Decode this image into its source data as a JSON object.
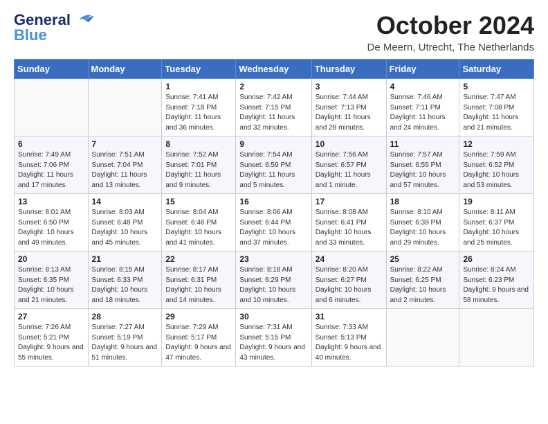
{
  "header": {
    "logo_general": "General",
    "logo_blue": "Blue",
    "month_title": "October 2024",
    "location": "De Meern, Utrecht, The Netherlands"
  },
  "days_of_week": [
    "Sunday",
    "Monday",
    "Tuesday",
    "Wednesday",
    "Thursday",
    "Friday",
    "Saturday"
  ],
  "weeks": [
    [
      {
        "day": "",
        "sunrise": "",
        "sunset": "",
        "daylight": ""
      },
      {
        "day": "",
        "sunrise": "",
        "sunset": "",
        "daylight": ""
      },
      {
        "day": "1",
        "sunrise": "Sunrise: 7:41 AM",
        "sunset": "Sunset: 7:18 PM",
        "daylight": "Daylight: 11 hours and 36 minutes."
      },
      {
        "day": "2",
        "sunrise": "Sunrise: 7:42 AM",
        "sunset": "Sunset: 7:15 PM",
        "daylight": "Daylight: 11 hours and 32 minutes."
      },
      {
        "day": "3",
        "sunrise": "Sunrise: 7:44 AM",
        "sunset": "Sunset: 7:13 PM",
        "daylight": "Daylight: 11 hours and 28 minutes."
      },
      {
        "day": "4",
        "sunrise": "Sunrise: 7:46 AM",
        "sunset": "Sunset: 7:11 PM",
        "daylight": "Daylight: 11 hours and 24 minutes."
      },
      {
        "day": "5",
        "sunrise": "Sunrise: 7:47 AM",
        "sunset": "Sunset: 7:08 PM",
        "daylight": "Daylight: 11 hours and 21 minutes."
      }
    ],
    [
      {
        "day": "6",
        "sunrise": "Sunrise: 7:49 AM",
        "sunset": "Sunset: 7:06 PM",
        "daylight": "Daylight: 11 hours and 17 minutes."
      },
      {
        "day": "7",
        "sunrise": "Sunrise: 7:51 AM",
        "sunset": "Sunset: 7:04 PM",
        "daylight": "Daylight: 11 hours and 13 minutes."
      },
      {
        "day": "8",
        "sunrise": "Sunrise: 7:52 AM",
        "sunset": "Sunset: 7:01 PM",
        "daylight": "Daylight: 11 hours and 9 minutes."
      },
      {
        "day": "9",
        "sunrise": "Sunrise: 7:54 AM",
        "sunset": "Sunset: 6:59 PM",
        "daylight": "Daylight: 11 hours and 5 minutes."
      },
      {
        "day": "10",
        "sunrise": "Sunrise: 7:56 AM",
        "sunset": "Sunset: 6:57 PM",
        "daylight": "Daylight: 11 hours and 1 minute."
      },
      {
        "day": "11",
        "sunrise": "Sunrise: 7:57 AM",
        "sunset": "Sunset: 6:55 PM",
        "daylight": "Daylight: 10 hours and 57 minutes."
      },
      {
        "day": "12",
        "sunrise": "Sunrise: 7:59 AM",
        "sunset": "Sunset: 6:52 PM",
        "daylight": "Daylight: 10 hours and 53 minutes."
      }
    ],
    [
      {
        "day": "13",
        "sunrise": "Sunrise: 8:01 AM",
        "sunset": "Sunset: 6:50 PM",
        "daylight": "Daylight: 10 hours and 49 minutes."
      },
      {
        "day": "14",
        "sunrise": "Sunrise: 8:03 AM",
        "sunset": "Sunset: 6:48 PM",
        "daylight": "Daylight: 10 hours and 45 minutes."
      },
      {
        "day": "15",
        "sunrise": "Sunrise: 8:04 AM",
        "sunset": "Sunset: 6:46 PM",
        "daylight": "Daylight: 10 hours and 41 minutes."
      },
      {
        "day": "16",
        "sunrise": "Sunrise: 8:06 AM",
        "sunset": "Sunset: 6:44 PM",
        "daylight": "Daylight: 10 hours and 37 minutes."
      },
      {
        "day": "17",
        "sunrise": "Sunrise: 8:08 AM",
        "sunset": "Sunset: 6:41 PM",
        "daylight": "Daylight: 10 hours and 33 minutes."
      },
      {
        "day": "18",
        "sunrise": "Sunrise: 8:10 AM",
        "sunset": "Sunset: 6:39 PM",
        "daylight": "Daylight: 10 hours and 29 minutes."
      },
      {
        "day": "19",
        "sunrise": "Sunrise: 8:11 AM",
        "sunset": "Sunset: 6:37 PM",
        "daylight": "Daylight: 10 hours and 25 minutes."
      }
    ],
    [
      {
        "day": "20",
        "sunrise": "Sunrise: 8:13 AM",
        "sunset": "Sunset: 6:35 PM",
        "daylight": "Daylight: 10 hours and 21 minutes."
      },
      {
        "day": "21",
        "sunrise": "Sunrise: 8:15 AM",
        "sunset": "Sunset: 6:33 PM",
        "daylight": "Daylight: 10 hours and 18 minutes."
      },
      {
        "day": "22",
        "sunrise": "Sunrise: 8:17 AM",
        "sunset": "Sunset: 6:31 PM",
        "daylight": "Daylight: 10 hours and 14 minutes."
      },
      {
        "day": "23",
        "sunrise": "Sunrise: 8:18 AM",
        "sunset": "Sunset: 6:29 PM",
        "daylight": "Daylight: 10 hours and 10 minutes."
      },
      {
        "day": "24",
        "sunrise": "Sunrise: 8:20 AM",
        "sunset": "Sunset: 6:27 PM",
        "daylight": "Daylight: 10 hours and 6 minutes."
      },
      {
        "day": "25",
        "sunrise": "Sunrise: 8:22 AM",
        "sunset": "Sunset: 6:25 PM",
        "daylight": "Daylight: 10 hours and 2 minutes."
      },
      {
        "day": "26",
        "sunrise": "Sunrise: 8:24 AM",
        "sunset": "Sunset: 6:23 PM",
        "daylight": "Daylight: 9 hours and 58 minutes."
      }
    ],
    [
      {
        "day": "27",
        "sunrise": "Sunrise: 7:26 AM",
        "sunset": "Sunset: 5:21 PM",
        "daylight": "Daylight: 9 hours and 55 minutes."
      },
      {
        "day": "28",
        "sunrise": "Sunrise: 7:27 AM",
        "sunset": "Sunset: 5:19 PM",
        "daylight": "Daylight: 9 hours and 51 minutes."
      },
      {
        "day": "29",
        "sunrise": "Sunrise: 7:29 AM",
        "sunset": "Sunset: 5:17 PM",
        "daylight": "Daylight: 9 hours and 47 minutes."
      },
      {
        "day": "30",
        "sunrise": "Sunrise: 7:31 AM",
        "sunset": "Sunset: 5:15 PM",
        "daylight": "Daylight: 9 hours and 43 minutes."
      },
      {
        "day": "31",
        "sunrise": "Sunrise: 7:33 AM",
        "sunset": "Sunset: 5:13 PM",
        "daylight": "Daylight: 9 hours and 40 minutes."
      },
      {
        "day": "",
        "sunrise": "",
        "sunset": "",
        "daylight": ""
      },
      {
        "day": "",
        "sunrise": "",
        "sunset": "",
        "daylight": ""
      }
    ]
  ]
}
